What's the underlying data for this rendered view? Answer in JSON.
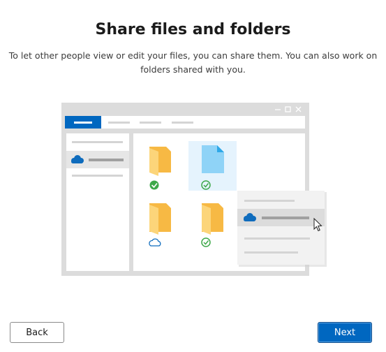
{
  "page": {
    "title": "Share files and folders",
    "subtitle": "To let other people view or edit your files, you can share them. You can also work on folders shared with you."
  },
  "buttons": {
    "back_label": "Back",
    "next_label": "Next"
  },
  "colors": {
    "accent": "#0067c0",
    "folder": "#f7b944",
    "success": "#3ea84a",
    "onedrive": "#0f6cbd",
    "file_highlight": "#e5f3fd"
  },
  "illustration": {
    "icons": [
      "onedrive-cloud-icon",
      "folder-icon",
      "file-icon",
      "checkmark-icon",
      "cloud-icon",
      "mouse-cursor-icon"
    ]
  }
}
